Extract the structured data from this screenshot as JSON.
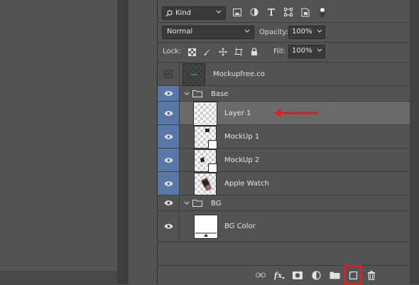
{
  "filter": {
    "kind_label": "Kind"
  },
  "blend": {
    "mode": "Normal",
    "opacity_label": "Opacity:",
    "opacity_value": "100%"
  },
  "lock": {
    "label": "Lock:",
    "fill_label": "Fill:",
    "fill_value": "100%"
  },
  "layers": [
    {
      "name": "Mockupfree.co",
      "type": "text-thumb",
      "visible": false
    },
    {
      "name": "Base",
      "type": "group",
      "visible": true
    },
    {
      "name": "Layer 1",
      "type": "layer",
      "visible": true,
      "selected": true
    },
    {
      "name": "MockUp 1",
      "type": "smart",
      "visible": true
    },
    {
      "name": "MockUp 2",
      "type": "smart",
      "visible": true
    },
    {
      "name": "Apple Watch",
      "type": "layer",
      "visible": true
    },
    {
      "name": "BG",
      "type": "group",
      "visible": true
    },
    {
      "name": "BG Color",
      "type": "layer",
      "visible": true
    }
  ],
  "colors": {
    "eye_on": "#5777a6",
    "selected_row": "#6a6a6a",
    "annotation": "#e01f1f"
  },
  "bottom_icons": [
    "link-icon",
    "fx-icon",
    "mask-icon",
    "adjustment-icon",
    "folder-icon",
    "new-layer-icon",
    "trash-icon"
  ]
}
